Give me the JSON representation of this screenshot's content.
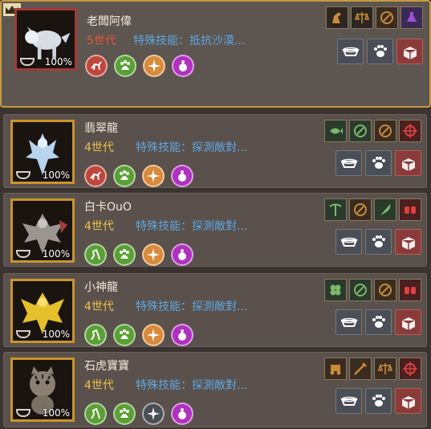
{
  "colors": {
    "accent_gold": "#c79a3e",
    "featured_gen": "#e8563f",
    "gen": "#f0c14b",
    "skill": "#5fa6e0"
  },
  "pets": [
    {
      "name": "老闆阿偉",
      "generation": "5世代",
      "skill": "特殊技能：抵抗沙漠...",
      "satiety": "100%",
      "featured": true,
      "portrait_icon": "white-wolf",
      "stats": [
        "red",
        "green",
        "orange",
        "purple"
      ],
      "traits": [
        "horse-icon",
        "scale-icon",
        "pickaxe-icon",
        "potion-icon"
      ]
    },
    {
      "name": "翡翠龍",
      "generation": "4世代",
      "skill": "特殊技能：探測敵對...",
      "satiety": "100%",
      "featured": false,
      "portrait_icon": "ice-dragon",
      "stats": [
        "red",
        "green",
        "orange",
        "purple"
      ],
      "traits": [
        "fish-icon",
        "axe-icon",
        "pickaxe-icon",
        "target-icon"
      ]
    },
    {
      "name": "白卡OuO",
      "generation": "4世代",
      "skill": "特殊技能：探測敵對...",
      "satiety": "100%",
      "featured": false,
      "portrait_icon": "gray-dragon",
      "stats": [
        "green",
        "green",
        "orange",
        "purple"
      ],
      "traits": [
        "pickaxe-icon",
        "axe-icon",
        "feather-icon",
        "gloves-icon"
      ]
    },
    {
      "name": "小神龍",
      "generation": "4世代",
      "skill": "特殊技能：探測敵對...",
      "satiety": "100%",
      "featured": false,
      "portrait_icon": "gold-dragon",
      "stats": [
        "green",
        "green",
        "orange",
        "purple"
      ],
      "traits": [
        "clover-icon",
        "axe-icon",
        "pickaxe-icon",
        "gloves-icon"
      ]
    },
    {
      "name": "石虎寶寶",
      "generation": "4世代",
      "skill": "特殊技能：探測敵對...",
      "satiety": "100%",
      "featured": false,
      "portrait_icon": "tiger-cat",
      "stats": [
        "green",
        "green",
        "gray",
        "purple"
      ],
      "traits": [
        "carriage-icon",
        "tool-icon",
        "scale-icon",
        "target-icon"
      ]
    }
  ],
  "action_icons": [
    "feed-bowl-icon",
    "paw-icon",
    "release-box-icon"
  ]
}
